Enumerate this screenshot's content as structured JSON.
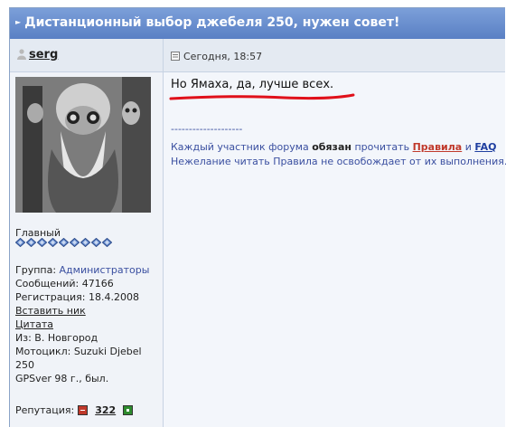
{
  "topic": {
    "title": "Дистанционный выбор джебеля 250, нужен совет!"
  },
  "post": {
    "author": "serg",
    "date": "Сегодня, 18:57",
    "message": "Но Ямаха, да, лучше всех.",
    "signature": {
      "separator": "--------------------",
      "line1_pre": "Каждый участник форума ",
      "line1_bold": "обязан",
      "line1_mid": " прочитать ",
      "rules_link": "Правила",
      "line1_and": " и ",
      "faq_link": "FAQ",
      "line2": "Нежелание читать Правила не освобождает от их выполнения."
    }
  },
  "profile": {
    "rank": "Главный",
    "stars_count": 9,
    "group_label": "Группа: ",
    "group_value": "Администраторы",
    "messages": "Сообщений: 47166",
    "registered": "Регистрация: 18.4.2008",
    "insert_nick": "Вставить ник",
    "quote": "Цитата",
    "city": "Из: В. Новгород",
    "bike_line1": "Мотоцикл: Suzuki Djebel 250",
    "bike_line2": "GPSver 98 г., был.",
    "reputation_label": "Репутация:",
    "reputation_value": "322"
  },
  "colors": {
    "title_bar": "#5a80c4",
    "link": "#3a4fa0",
    "rules_red": "#c0392b",
    "underline_red": "#e0101a"
  }
}
